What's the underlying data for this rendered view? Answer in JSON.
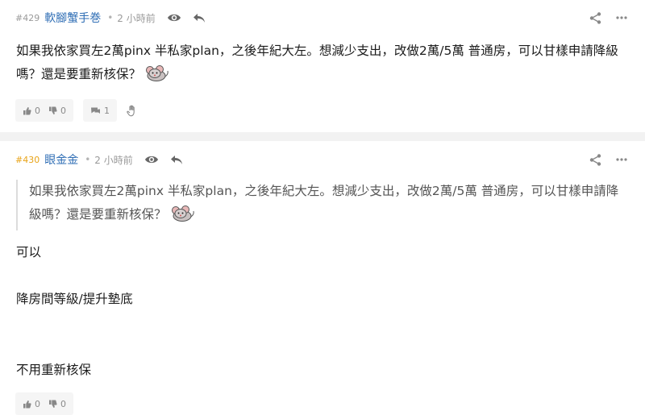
{
  "posts": [
    {
      "number": "#429",
      "author": "軟腳蟹手巻",
      "separator": "•",
      "time": "2 小時前",
      "body": "如果我依家買左2萬pinx 半私家plan，之後年紀大左。想減少支出，改做2萬/5萬 普通房，可以甘樣申請降級嗎？還是要重新核保？",
      "upvotes": "0",
      "downvotes": "0",
      "replies": "1",
      "icons": [
        "eye-icon",
        "reply-icon",
        "share-icon",
        "more-icon",
        "thumb-up-icon",
        "thumb-down-icon",
        "comment-icon",
        "hand-icon"
      ]
    },
    {
      "number": "#430",
      "author": "眼金金",
      "separator": "•",
      "time": "2 小時前",
      "quote": "如果我依家買左2萬pinx 半私家plan，之後年紀大左。想減少支出，改做2萬/5萬 普通房，可以甘樣申請降級嗎？還是要重新核保？",
      "lines": [
        "可以",
        "降房間等級/提升墊底",
        "不用重新核保"
      ],
      "upvotes": "0",
      "downvotes": "0",
      "icons": [
        "eye-icon",
        "reply-icon",
        "share-icon",
        "more-icon",
        "thumb-up-icon",
        "thumb-down-icon"
      ]
    }
  ],
  "colors": {
    "author": "#2f6eb5",
    "op_number": "#e8a317",
    "divider": "#f2f2f2"
  }
}
